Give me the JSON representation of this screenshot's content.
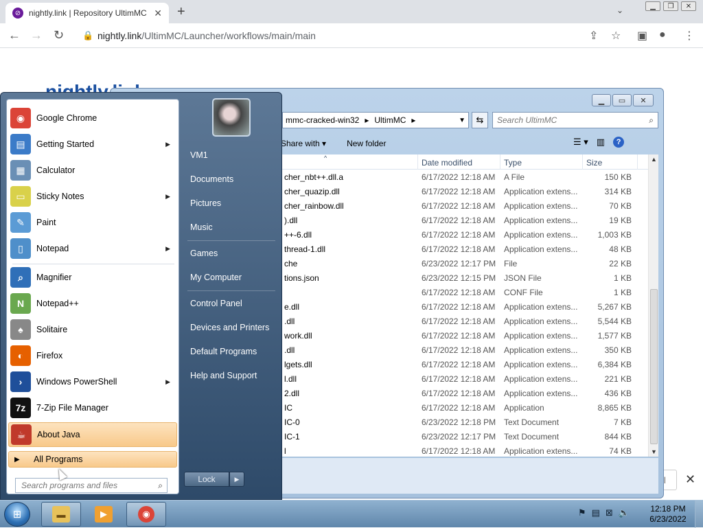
{
  "browser": {
    "tab_title": "nightly.link | Repository UltimMC",
    "url_domain": "nightly.link",
    "url_path": "/UltimMC/Launcher/workflows/main/main",
    "page_logo": "nightly.link",
    "page_button_label": "ll"
  },
  "explorer": {
    "breadcrumb": [
      "mmc-cracked-win32",
      "UltimMC"
    ],
    "search_placeholder": "Search UltimMC",
    "commands": [
      "Share with",
      "New folder"
    ],
    "columns": {
      "date": "Date modified",
      "type": "Type",
      "size": "Size"
    },
    "files": [
      {
        "name": "cher_nbt++.dll.a",
        "date": "6/17/2022 12:18 AM",
        "type": "A File",
        "size": "150 KB"
      },
      {
        "name": "cher_quazip.dll",
        "date": "6/17/2022 12:18 AM",
        "type": "Application extens...",
        "size": "314 KB"
      },
      {
        "name": "cher_rainbow.dll",
        "date": "6/17/2022 12:18 AM",
        "type": "Application extens...",
        "size": "70 KB"
      },
      {
        "name": ").dll",
        "date": "6/17/2022 12:18 AM",
        "type": "Application extens...",
        "size": "19 KB"
      },
      {
        "name": "++-6.dll",
        "date": "6/17/2022 12:18 AM",
        "type": "Application extens...",
        "size": "1,003 KB"
      },
      {
        "name": "thread-1.dll",
        "date": "6/17/2022 12:18 AM",
        "type": "Application extens...",
        "size": "48 KB"
      },
      {
        "name": "che",
        "date": "6/23/2022 12:17 PM",
        "type": "File",
        "size": "22 KB"
      },
      {
        "name": "tions.json",
        "date": "6/23/2022 12:15 PM",
        "type": "JSON File",
        "size": "1 KB"
      },
      {
        "name": "",
        "date": "6/17/2022 12:18 AM",
        "type": "CONF File",
        "size": "1 KB"
      },
      {
        "name": "e.dll",
        "date": "6/17/2022 12:18 AM",
        "type": "Application extens...",
        "size": "5,267 KB"
      },
      {
        "name": ".dll",
        "date": "6/17/2022 12:18 AM",
        "type": "Application extens...",
        "size": "5,544 KB"
      },
      {
        "name": "work.dll",
        "date": "6/17/2022 12:18 AM",
        "type": "Application extens...",
        "size": "1,577 KB"
      },
      {
        "name": ".dll",
        "date": "6/17/2022 12:18 AM",
        "type": "Application extens...",
        "size": "350 KB"
      },
      {
        "name": "lgets.dll",
        "date": "6/17/2022 12:18 AM",
        "type": "Application extens...",
        "size": "6,384 KB"
      },
      {
        "name": "l.dll",
        "date": "6/17/2022 12:18 AM",
        "type": "Application extens...",
        "size": "221 KB"
      },
      {
        "name": "2.dll",
        "date": "6/17/2022 12:18 AM",
        "type": "Application extens...",
        "size": "436 KB"
      },
      {
        "name": "IC",
        "date": "6/17/2022 12:18 AM",
        "type": "Application",
        "size": "8,865 KB"
      },
      {
        "name": "IC-0",
        "date": "6/23/2022 12:18 PM",
        "type": "Text Document",
        "size": "7 KB"
      },
      {
        "name": "IC-1",
        "date": "6/23/2022 12:17 PM",
        "type": "Text Document",
        "size": "844 KB"
      },
      {
        "name": "l",
        "date": "6/17/2022 12:18 AM",
        "type": "Application extens...",
        "size": "74 KB"
      }
    ]
  },
  "startmenu": {
    "pinned": [
      {
        "label": "Google Chrome",
        "icon": "chrome-icon",
        "color": "#db4437",
        "glyph": "◉",
        "submenu": false
      },
      {
        "label": "Getting Started",
        "icon": "getting-started-icon",
        "color": "#3b7bc8",
        "glyph": "▤",
        "submenu": true
      },
      {
        "label": "Calculator",
        "icon": "calculator-icon",
        "color": "#6a8fb5",
        "glyph": "▦",
        "submenu": false
      },
      {
        "label": "Sticky Notes",
        "icon": "sticky-notes-icon",
        "color": "#d9d14a",
        "glyph": "▭",
        "submenu": true
      },
      {
        "label": "Paint",
        "icon": "paint-icon",
        "color": "#5b9bd5",
        "glyph": "✎",
        "submenu": false
      },
      {
        "label": "Notepad",
        "icon": "notepad-icon",
        "color": "#4f8fca",
        "glyph": "▯",
        "submenu": true
      }
    ],
    "recent": [
      {
        "label": "Magnifier",
        "icon": "magnifier-icon",
        "color": "#2f6fb8",
        "glyph": "⌕",
        "submenu": false
      },
      {
        "label": "Notepad++",
        "icon": "notepad-plus-plus-icon",
        "color": "#6aa84f",
        "glyph": "N",
        "submenu": false
      },
      {
        "label": "Solitaire",
        "icon": "solitaire-icon",
        "color": "#888888",
        "glyph": "♠",
        "submenu": false
      },
      {
        "label": "Firefox",
        "icon": "firefox-icon",
        "color": "#e66000",
        "glyph": "◐",
        "submenu": false
      },
      {
        "label": "Windows PowerShell",
        "icon": "powershell-icon",
        "color": "#1f4f9a",
        "glyph": "›",
        "submenu": true
      },
      {
        "label": "7-Zip File Manager",
        "icon": "7zip-icon",
        "color": "#111111",
        "glyph": "7z",
        "submenu": false
      },
      {
        "label": "About Java",
        "icon": "java-icon",
        "color": "#c0392b",
        "glyph": "☕",
        "submenu": false,
        "selected": true
      }
    ],
    "all_programs": "All Programs",
    "search_placeholder": "Search programs and files",
    "right_links": [
      "VM1",
      "Documents",
      "Pictures",
      "Music",
      "Games",
      "My Computer",
      "Control Panel",
      "Devices and Printers",
      "Default Programs",
      "Help and Support"
    ],
    "lock_label": "Lock"
  },
  "taskbar": {
    "time": "12:18 PM",
    "date": "6/23/2022"
  }
}
